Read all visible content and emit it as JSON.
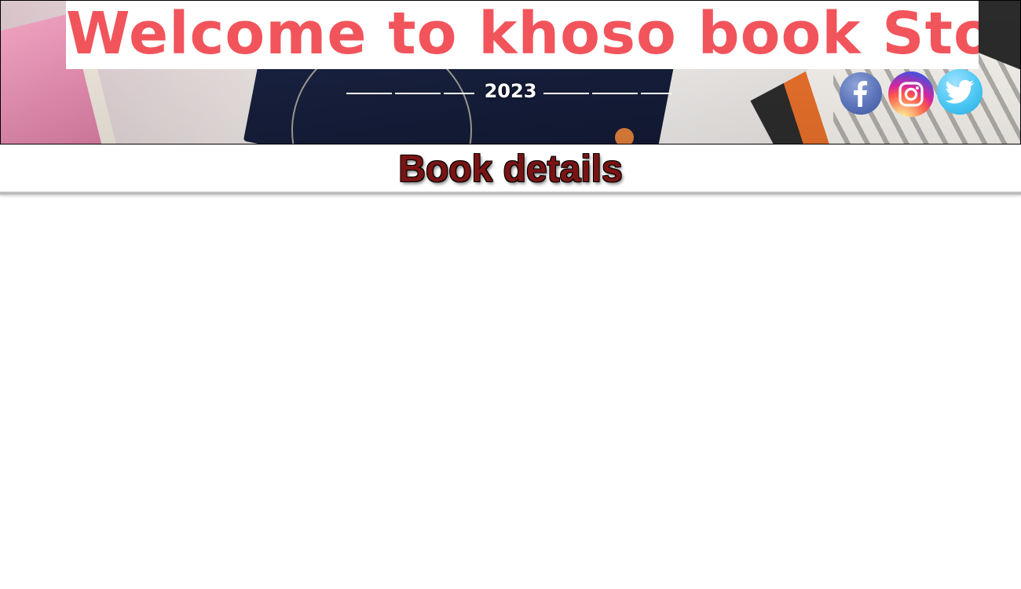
{
  "header": {
    "site_title": "Welcome to khoso book Store",
    "year": "2023",
    "title_color": "#f2545b",
    "social": [
      {
        "name": "facebook",
        "icon": "facebook-icon",
        "color": "#5a73b9"
      },
      {
        "name": "instagram",
        "icon": "instagram-icon",
        "color": "#d6249f"
      },
      {
        "name": "twitter",
        "icon": "twitter-icon",
        "color": "#4cc7f4"
      }
    ]
  },
  "main": {
    "page_title": "Book details",
    "page_title_color": "#7a1414"
  }
}
